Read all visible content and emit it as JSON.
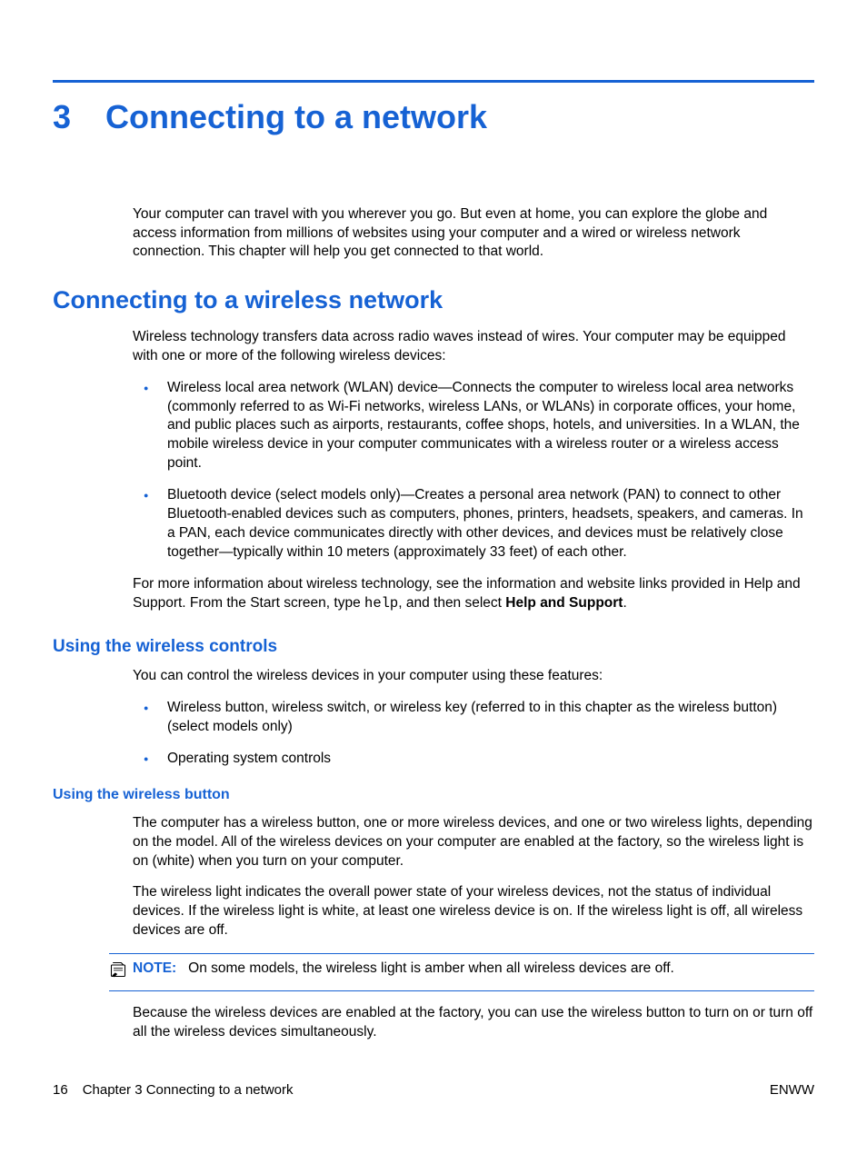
{
  "chapter": {
    "number": "3",
    "title": "Connecting to a network"
  },
  "intro": "Your computer can travel with you wherever you go. But even at home, you can explore the globe and access information from millions of websites using your computer and a wired or wireless network connection. This chapter will help you get connected to that world.",
  "s1": {
    "heading": "Connecting to a wireless network",
    "p1": "Wireless technology transfers data across radio waves instead of wires. Your computer may be equipped with one or more of the following wireless devices:",
    "bullets": [
      "Wireless local area network (WLAN) device—Connects the computer to wireless local area networks (commonly referred to as Wi-Fi networks, wireless LANs, or WLANs) in corporate offices, your home, and public places such as airports, restaurants, coffee shops, hotels, and universities. In a WLAN, the mobile wireless device in your computer communicates with a wireless router or a wireless access point.",
      "Bluetooth device (select models only)—Creates a personal area network (PAN) to connect to other Bluetooth-enabled devices such as computers, phones, printers, headsets, speakers, and cameras. In a PAN, each device communicates directly with other devices, and devices must be relatively close together—typically within 10 meters (approximately 33 feet) of each other."
    ],
    "p2a": "For more information about wireless technology, see the information and website links provided in Help and Support. From the Start screen, type ",
    "p2code": "help",
    "p2b": ", and then select ",
    "p2bold": "Help and Support",
    "p2c": "."
  },
  "s2": {
    "heading": "Using the wireless controls",
    "p1": "You can control the wireless devices in your computer using these features:",
    "bullets": [
      "Wireless button, wireless switch, or wireless key (referred to in this chapter as the wireless button) (select models only)",
      "Operating system controls"
    ]
  },
  "s3": {
    "heading": "Using the wireless button",
    "p1": "The computer has a wireless button, one or more wireless devices, and one or two wireless lights, depending on the model. All of the wireless devices on your computer are enabled at the factory, so the wireless light is on (white) when you turn on your computer.",
    "p2": "The wireless light indicates the overall power state of your wireless devices, not the status of individual devices. If the wireless light is white, at least one wireless device is on. If the wireless light is off, all wireless devices are off.",
    "noteLabel": "NOTE:",
    "noteText": "On some models, the wireless light is amber when all wireless devices are off.",
    "p3": "Because the wireless devices are enabled at the factory, you can use the wireless button to turn on or turn off all the wireless devices simultaneously."
  },
  "footer": {
    "page": "16",
    "chapterLabel": "Chapter 3   Connecting to a network",
    "right": "ENWW"
  }
}
